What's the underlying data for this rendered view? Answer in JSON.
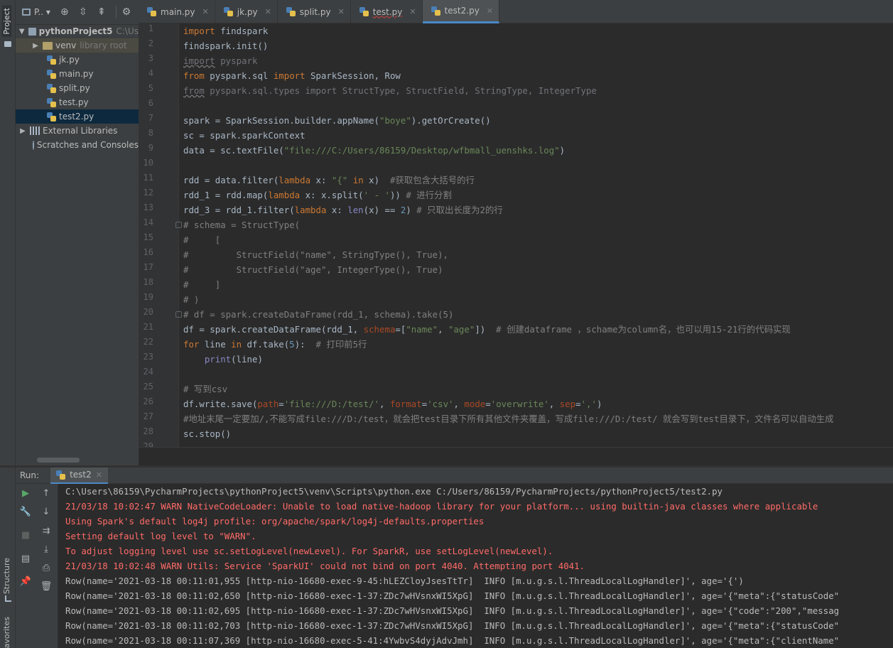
{
  "tool_windows": {
    "project": "Project",
    "structure": "Structure",
    "favorites": "avorites"
  },
  "project_panel": {
    "title": "P..",
    "tree": [
      {
        "label": "pythonProject5",
        "suffix": "C:\\Us",
        "type": "folder",
        "expanded": true
      },
      {
        "label": "venv",
        "suffix": "library root",
        "type": "venv-folder",
        "expanded": false
      },
      {
        "label": "jk.py",
        "type": "py"
      },
      {
        "label": "main.py",
        "type": "py"
      },
      {
        "label": "split.py",
        "type": "py"
      },
      {
        "label": "test.py",
        "type": "py"
      },
      {
        "label": "test2.py",
        "type": "py",
        "selected": true
      },
      {
        "label": "External Libraries",
        "type": "libraries",
        "expanded": false
      },
      {
        "label": "Scratches and Consoles",
        "type": "scratches"
      }
    ]
  },
  "tabs": [
    {
      "label": "main.py",
      "active": false
    },
    {
      "label": "jk.py",
      "active": false
    },
    {
      "label": "split.py",
      "active": false
    },
    {
      "label": "test.py",
      "active": false,
      "error": true
    },
    {
      "label": "test2.py",
      "active": true
    }
  ],
  "editor": {
    "line_numbers": [
      "1",
      "2",
      "3",
      "4",
      "5",
      "6",
      "7",
      "8",
      "9",
      "10",
      "11",
      "12",
      "13",
      "14",
      "15",
      "16",
      "17",
      "18",
      "19",
      "20",
      "21",
      "22",
      "23",
      "24",
      "25",
      "26",
      "27",
      "28",
      "29"
    ],
    "lines": [
      "import findspark",
      "findspark.init()",
      "import pyspark",
      "from pyspark.sql import SparkSession, Row",
      "from pyspark.sql.types import StructType, StructField, StringType, IntegerType",
      "",
      "spark = SparkSession.builder.appName(\"boye\").getOrCreate()",
      "sc = spark.sparkContext",
      "data = sc.textFile(\"file:///C:/Users/86159/Desktop/wfbmall_uenshks.log\")",
      "",
      "rdd = data.filter(lambda x: \"{\" in x)  #获取包含大括号的行",
      "rdd_1 = rdd.map(lambda x: x.split(' - ')) # 进行分割",
      "rdd_3 = rdd_1.filter(lambda x: len(x) == 2) # 只取出长度为2的行",
      "# schema = StructType(",
      "#     [",
      "#         StructField(\"name\", StringType(), True),",
      "#         StructField(\"age\", IntegerType(), True)",
      "#     ]",
      "# )",
      "# df = spark.createDataFrame(rdd_1, schema).take(5)",
      "df = spark.createDataFrame(rdd_1, schema=[\"name\", \"age\"])  # 创建dataframe ，schame为column名，也可以用15-21行的代码实现",
      "for line in df.take(5):  # 打印前5行",
      "    print(line)",
      "",
      "# 写到csv",
      "df.write.save(path='file:///D:/test/', format='csv', mode='overwrite', sep=',')",
      "#地址末尾一定要加/,不能写成file:///D:/test，就会把test目录下所有其他文件夹覆盖，写成file:///D:/test/ 就会写到test目录下，文件名可以自动生成",
      "sc.stop()"
    ]
  },
  "run_panel": {
    "label": "Run:",
    "tab_label": "test2",
    "console": [
      {
        "text": "C:\\Users\\86159\\PycharmProjects\\pythonProject5\\venv\\Scripts\\python.exe C:/Users/86159/PycharmProjects/pythonProject5/test2.py",
        "kind": "normal"
      },
      {
        "text": "21/03/18 10:02:47 WARN NativeCodeLoader: Unable to load native-hadoop library for your platform... using builtin-java classes where applicable",
        "kind": "err"
      },
      {
        "text": "Using Spark's default log4j profile: org/apache/spark/log4j-defaults.properties",
        "kind": "err"
      },
      {
        "text": "Setting default log level to \"WARN\".",
        "kind": "err"
      },
      {
        "text": "To adjust logging level use sc.setLogLevel(newLevel). For SparkR, use setLogLevel(newLevel).",
        "kind": "err"
      },
      {
        "text": "21/03/18 10:02:48 WARN Utils: Service 'SparkUI' could not bind on port 4040. Attempting port 4041.",
        "kind": "err"
      },
      {
        "text": "Row(name='2021-03-18 00:11:01,955 [http-nio-16680-exec-9-45:hLEZCloyJsesTtTr]  INFO [m.u.g.s.l.ThreadLocalLogHandler]', age='{')",
        "kind": "normal"
      },
      {
        "text": "Row(name='2021-03-18 00:11:02,650 [http-nio-16680-exec-1-37:ZDc7wHVsnxWI5XpG]  INFO [m.u.g.s.l.ThreadLocalLogHandler]', age='{\"meta\":{\"statusCode\"",
        "kind": "normal"
      },
      {
        "text": "Row(name='2021-03-18 00:11:02,695 [http-nio-16680-exec-1-37:ZDc7wHVsnxWI5XpG]  INFO [m.u.g.s.l.ThreadLocalLogHandler]', age='{\"code\":\"200\",\"messag",
        "kind": "normal"
      },
      {
        "text": "Row(name='2021-03-18 00:11:02,703 [http-nio-16680-exec-1-37:ZDc7wHVsnxWI5XpG]  INFO [m.u.g.s.l.ThreadLocalLogHandler]', age='{\"meta\":{\"statusCode\"",
        "kind": "normal"
      },
      {
        "text": "Row(name='2021-03-18 00:11:07,369 [http-nio-16680-exec-5-41:4YwbvS4dyjAdvJmh]  INFO [m.u.g.s.l.ThreadLocalLogHandler]', age='{\"meta\":{\"clientName\"",
        "kind": "normal"
      }
    ]
  }
}
